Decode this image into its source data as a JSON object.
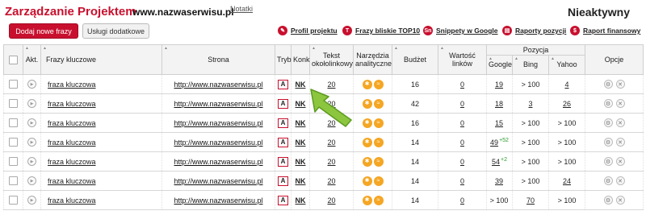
{
  "header": {
    "title": "Zarządzanie Projektem",
    "domain": "www.nazwaserwisu.pl",
    "notes_label": "Notatki",
    "status": "Nieaktywny"
  },
  "toolbar": {
    "add_label": "Dodaj nowe frazy",
    "services_label": "Usługi dodatkowe"
  },
  "links": [
    {
      "icon": "wrench-icon",
      "glyph": "✎",
      "label": "Profil projektu"
    },
    {
      "icon": "top10-icon",
      "glyph": "T",
      "label": "Frazy bliskie TOP10"
    },
    {
      "icon": "snippets-icon",
      "glyph": "Sn",
      "label": "Snippety w Google"
    },
    {
      "icon": "report-icon",
      "glyph": "▤",
      "label": "Raporty pozycji"
    },
    {
      "icon": "finance-icon",
      "glyph": "$",
      "label": "Raport finansowy"
    }
  ],
  "columns": {
    "akt": "Akt.",
    "keywords": "Frazy kluczowe",
    "site": "Strona",
    "mode": "Tryb",
    "konk": "Konk.",
    "text": "Tekst okołolinkowy",
    "tools": "Narzędzia analityczne",
    "budget": "Budżet",
    "links_value": "Wartość linków",
    "position": "Pozycja",
    "google": "Google",
    "bing": "Bing",
    "yahoo": "Yahoo",
    "options": "Opcje"
  },
  "rows": [
    {
      "keyword": "fraza kluczowa",
      "site": "http://www.nazwaserwisu.pl",
      "mode": "A",
      "konk": "NK",
      "text": "20",
      "budget": "16",
      "links": "0",
      "google": "19",
      "google_delta": "",
      "bing": "> 100",
      "yahoo": "4"
    },
    {
      "keyword": "fraza kluczowa",
      "site": "http://www.nazwaserwisu.pl",
      "mode": "A",
      "konk": "NK",
      "text": "20",
      "budget": "42",
      "links": "0",
      "google": "18",
      "google_delta": "",
      "bing": "3",
      "yahoo": "26"
    },
    {
      "keyword": "fraza kluczowa",
      "site": "http://www.nazwaserwisu.pl",
      "mode": "A",
      "konk": "NK",
      "text": "20",
      "budget": "16",
      "links": "0",
      "google": "15",
      "google_delta": "",
      "bing": "> 100",
      "yahoo": "> 100"
    },
    {
      "keyword": "fraza kluczowa",
      "site": "http://www.nazwaserwisu.pl",
      "mode": "A",
      "konk": "NK",
      "text": "20",
      "budget": "14",
      "links": "0",
      "google": "49",
      "google_delta": "+52",
      "bing": "> 100",
      "yahoo": "> 100"
    },
    {
      "keyword": "fraza kluczowa",
      "site": "http://www.nazwaserwisu.pl",
      "mode": "A",
      "konk": "NK",
      "text": "20",
      "budget": "14",
      "links": "0",
      "google": "54",
      "google_delta": "+2",
      "bing": "> 100",
      "yahoo": "> 100"
    },
    {
      "keyword": "fraza kluczowa",
      "site": "http://www.nazwaserwisu.pl",
      "mode": "A",
      "konk": "NK",
      "text": "20",
      "budget": "14",
      "links": "0",
      "google": "39",
      "google_delta": "",
      "bing": "> 100",
      "yahoo": "24"
    },
    {
      "keyword": "fraza kluczowa",
      "site": "http://www.nazwaserwisu.pl",
      "mode": "A",
      "konk": "NK",
      "text": "20",
      "budget": "14",
      "links": "0",
      "google": "> 100",
      "google_delta": "",
      "bing": "70",
      "yahoo": "> 100"
    }
  ],
  "colors": {
    "brand": "#c8102e",
    "tool": "#f5a623",
    "delta": "#2b9a2b",
    "pointer": "#8cc63f"
  }
}
